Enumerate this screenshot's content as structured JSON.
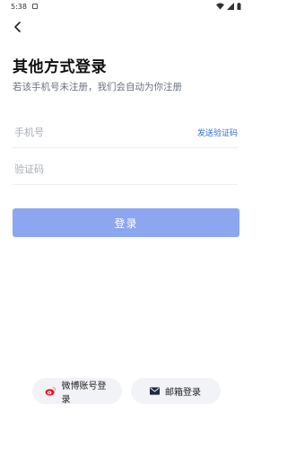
{
  "status": {
    "time": "5:38"
  },
  "header": {
    "title": "其他方式登录",
    "subtitle": "若该手机号未注册，我们会自动为你注册"
  },
  "form": {
    "phone_placeholder": "手机号",
    "send_code_label": "发送验证码",
    "code_placeholder": "验证码",
    "login_label": "登录"
  },
  "alt_login": {
    "weibo_label": "微博账号登录",
    "mail_label": "邮箱登录"
  },
  "colors": {
    "accent": "#8ca6f0",
    "link": "#2f6fd6",
    "weibo": "#e6162d"
  }
}
